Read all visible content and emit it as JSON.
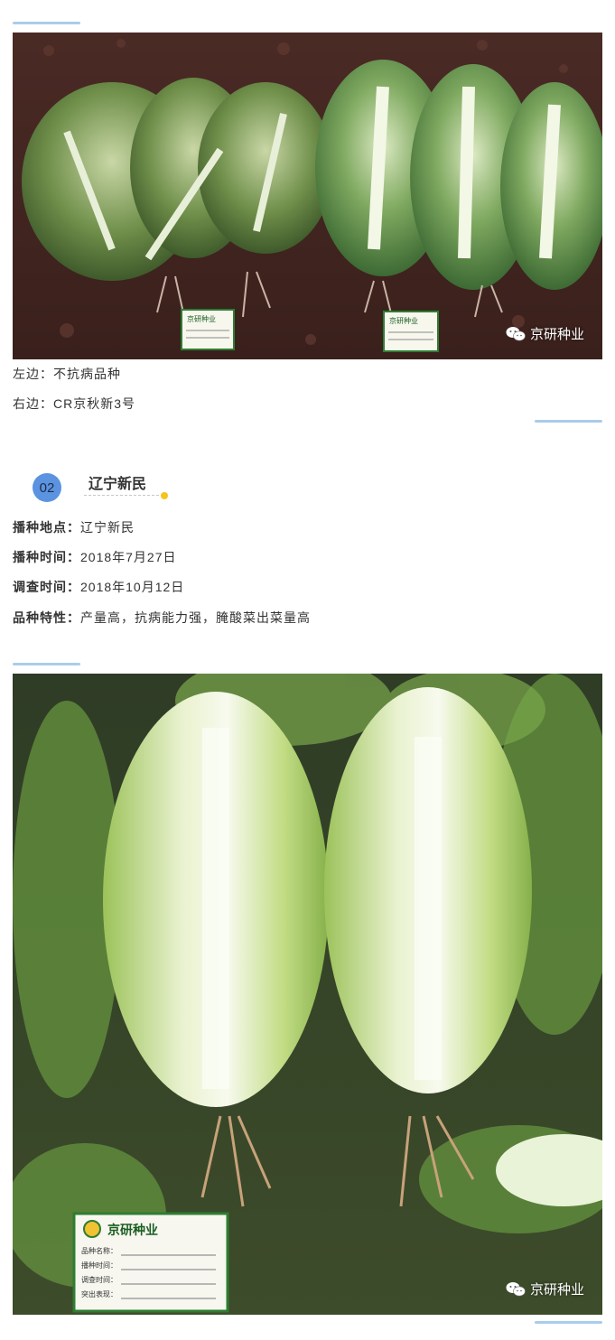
{
  "image1": {
    "alt": "白菜抗病对比",
    "watermark": "京研种业",
    "label_tags": [
      "京研种业",
      "京研种业"
    ]
  },
  "captions": {
    "left": "左边：不抗病品种",
    "right": "右边：CR京秋新3号"
  },
  "section": {
    "number": "02",
    "title": "辽宁新民"
  },
  "info": [
    {
      "label": "播种地点：",
      "value": "辽宁新民"
    },
    {
      "label": "播种时间：",
      "value": "2018年7月27日"
    },
    {
      "label": "调查时间：",
      "value": "2018年10月12日"
    },
    {
      "label": "品种特性：",
      "value": "产量高，抗病能力强，腌酸菜出菜量高"
    }
  ],
  "image2": {
    "alt": "白菜",
    "watermark": "京研种业",
    "label_brand": "京研种业",
    "label_lines": [
      "品种名称：",
      "播种时间：",
      "调查时间：",
      "突出表现："
    ]
  },
  "colors": {
    "accent_line": "#a9cdea",
    "badge_bg": "#5b93e0",
    "title_dot": "#f7c31c"
  }
}
